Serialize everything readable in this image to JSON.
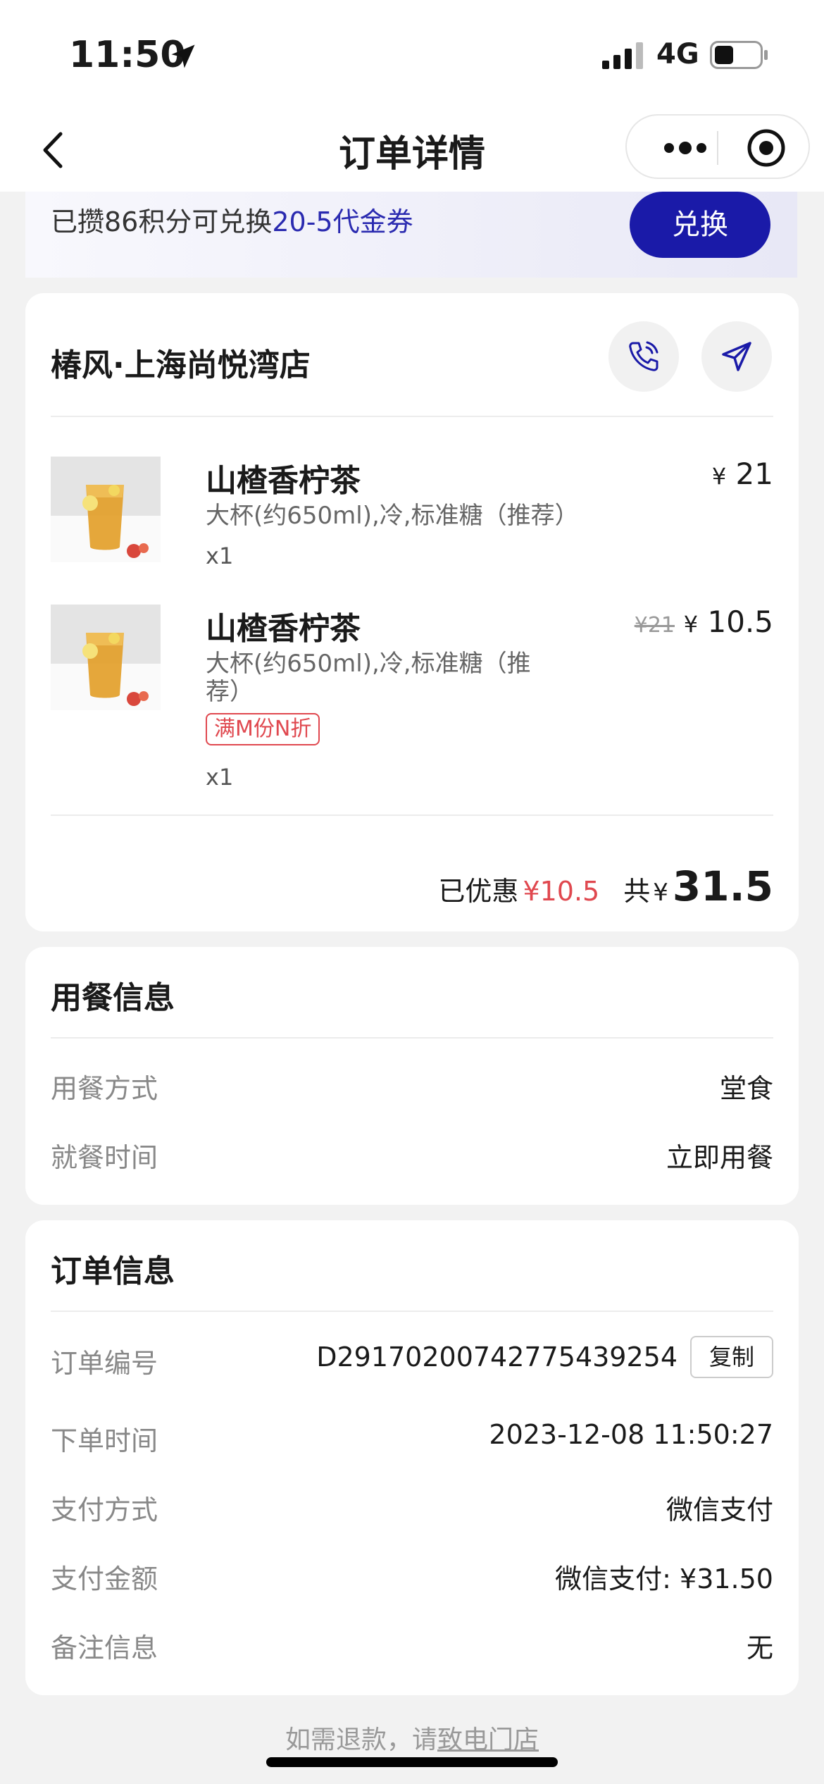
{
  "status_bar": {
    "time": "11:50",
    "network": "4G"
  },
  "nav": {
    "title": "订单详情"
  },
  "points": {
    "text_prefix": "已攒86积分可兑换",
    "text_highlight": "20-5代金券",
    "exchange_label": "兑换"
  },
  "store": {
    "name": "椿风·上海尚悦湾店"
  },
  "products": [
    {
      "name": "山楂香柠茶",
      "spec": "大杯(约650ml),冷,标准糖（推荐）",
      "qty": "x1",
      "currency": "¥",
      "price": "21"
    },
    {
      "name": "山楂香柠茶",
      "spec_line1": "大杯(约650ml),冷,标准糖（推",
      "spec_line2": "荐）",
      "promo": "满M份N折",
      "qty": "x1",
      "old_price": "¥21",
      "currency": "¥",
      "price": "10.5"
    }
  ],
  "summary": {
    "discount_label": "已优惠",
    "discount_value": "¥10.5",
    "total_label": "共",
    "total_currency": "¥",
    "total_value": "31.5"
  },
  "dining": {
    "title": "用餐信息",
    "rows": [
      {
        "key": "用餐方式",
        "value": "堂食"
      },
      {
        "key": "就餐时间",
        "value": "立即用餐"
      }
    ]
  },
  "order": {
    "title": "订单信息",
    "id_label": "订单编号",
    "id_value": "D29170200742775439254",
    "copy_label": "复制",
    "rows": [
      {
        "key": "下单时间",
        "value": "2023-12-08 11:50:27"
      },
      {
        "key": "支付方式",
        "value": "微信支付"
      },
      {
        "key": "支付金额",
        "value": "微信支付: ¥31.50"
      },
      {
        "key": "备注信息",
        "value": "无"
      }
    ]
  },
  "footer": {
    "prefix": "如需退款，请",
    "link": "致电门店"
  },
  "colors": {
    "accent": "#1a1aa8",
    "highlight": "#2a2ab0",
    "discount": "#e0484f"
  }
}
